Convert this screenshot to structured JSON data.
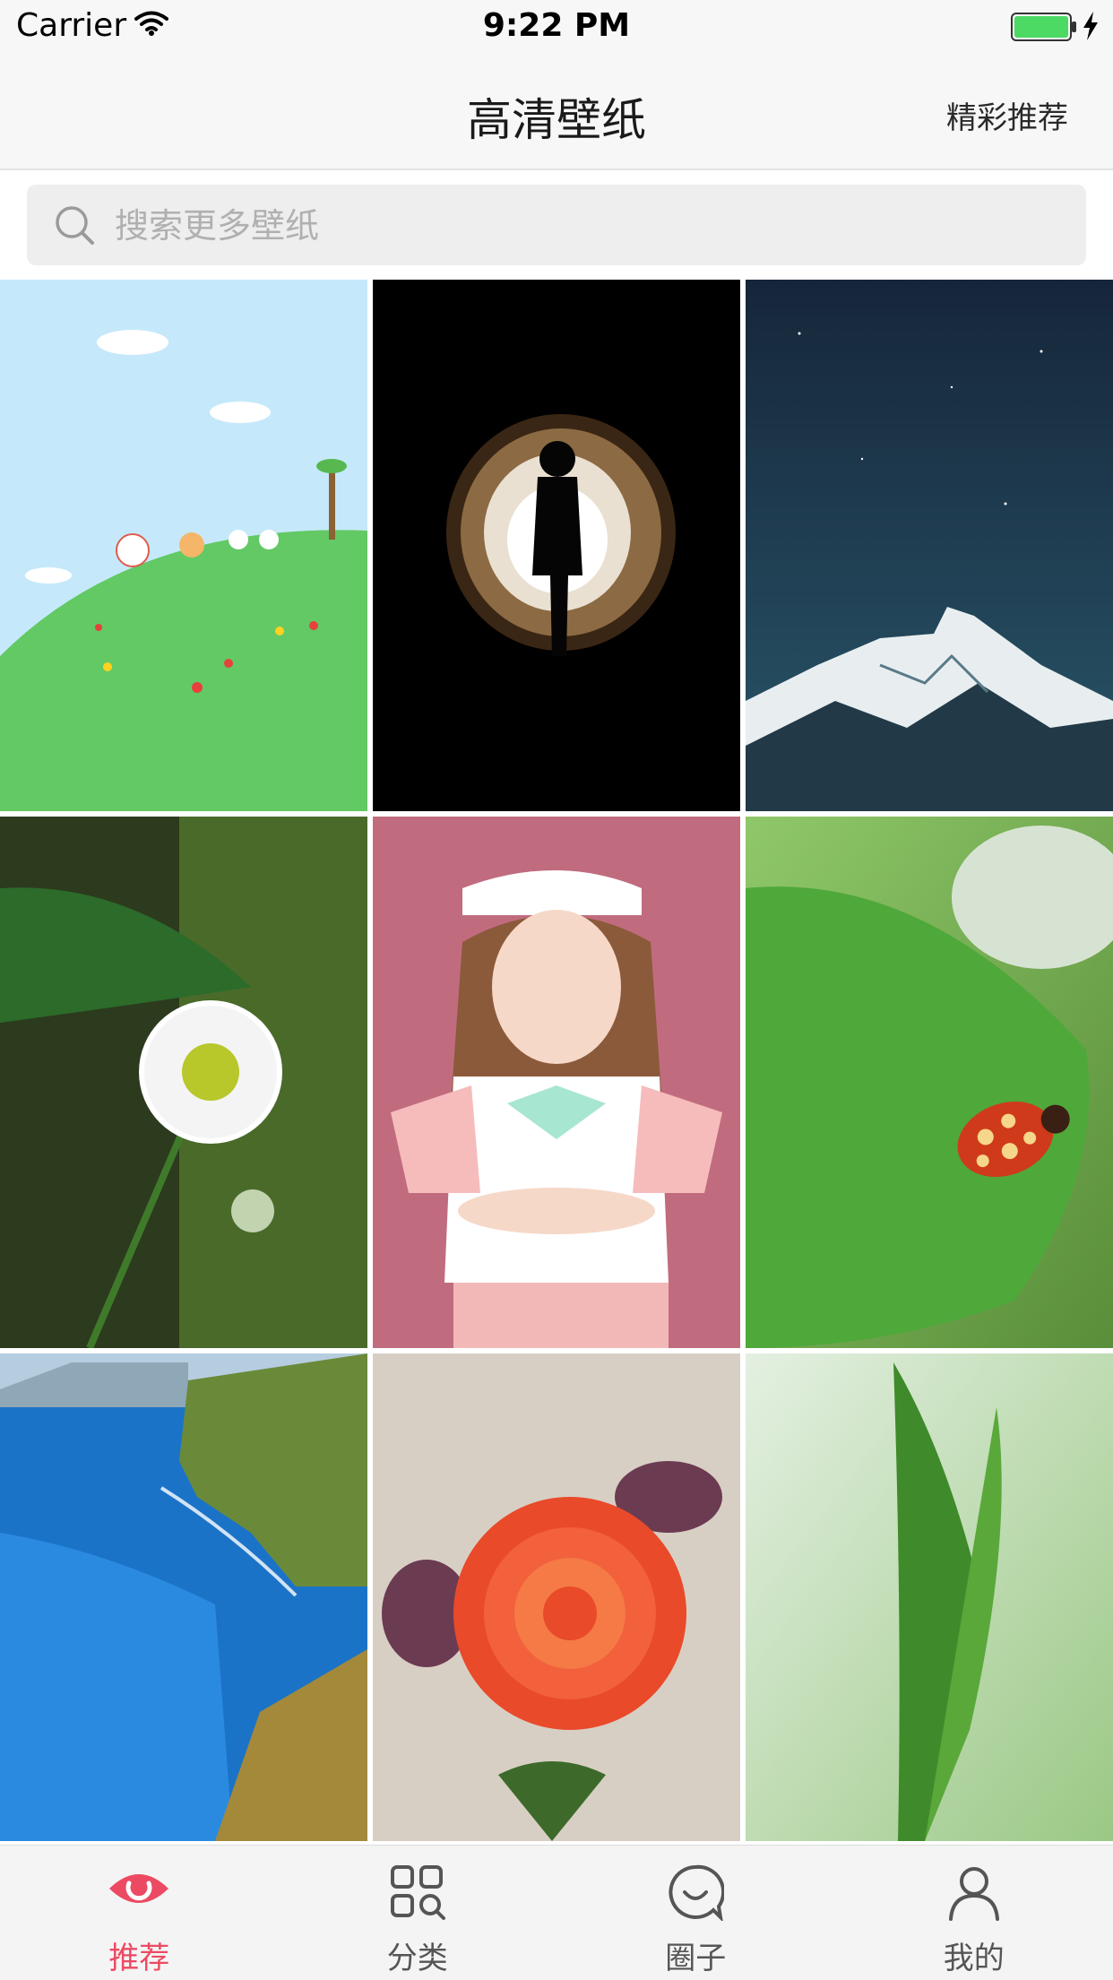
{
  "status_bar": {
    "carrier": "Carrier",
    "time": "9:22 PM",
    "battery_color": "#4cd964"
  },
  "nav": {
    "title": "高清壁纸",
    "right_button": "精彩推荐"
  },
  "search": {
    "placeholder": "搜索更多壁纸",
    "value": ""
  },
  "wallpapers": [
    {
      "subject": "cartoon animals on green hill"
    },
    {
      "subject": "silhouette in tunnel"
    },
    {
      "subject": "snowy mountain under starry sky"
    },
    {
      "subject": "white daisy flower"
    },
    {
      "subject": "girl in maid costume"
    },
    {
      "subject": "ladybug on green leaf"
    },
    {
      "subject": "blue sea coastline"
    },
    {
      "subject": "orange rose"
    },
    {
      "subject": "green plant sprout"
    }
  ],
  "tab_bar": {
    "accent_color": "#ec4a63",
    "tabs": [
      {
        "label": "推荐",
        "icon": "eye-icon",
        "active": true
      },
      {
        "label": "分类",
        "icon": "grid-search-icon",
        "active": false
      },
      {
        "label": "圈子",
        "icon": "chat-bubble-icon",
        "active": false
      },
      {
        "label": "我的",
        "icon": "user-icon",
        "active": false
      }
    ]
  }
}
